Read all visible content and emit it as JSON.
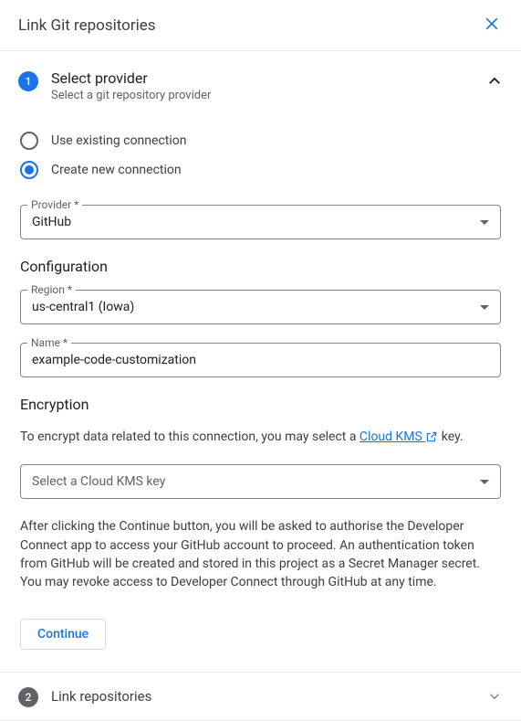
{
  "dialog": {
    "title": "Link Git repositories"
  },
  "step1": {
    "number": "1",
    "title": "Select provider",
    "subtitle": "Select a git repository provider"
  },
  "radio": {
    "existing_label": "Use existing connection",
    "new_label": "Create new connection"
  },
  "provider_field": {
    "label": "Provider *",
    "value": "GitHub"
  },
  "config": {
    "heading": "Configuration",
    "region_label": "Region *",
    "region_value": "us-central1 (Iowa)",
    "name_label": "Name *",
    "name_value": "example-code-customization"
  },
  "encryption": {
    "heading": "Encryption",
    "info_prefix": "To encrypt data related to this connection, you may select a ",
    "link_text": "Cloud KMS",
    "info_suffix": " key.",
    "kms_placeholder": "Select a Cloud KMS key"
  },
  "footer": {
    "disclaimer": "After clicking the Continue button, you will be asked to authorise the Developer Connect app to access your GitHub account to proceed. An authentication token from GitHub will be created and stored in this project as a Secret Manager secret. You may revoke access to Developer Connect through GitHub at any time.",
    "continue_label": "Continue"
  },
  "step2": {
    "number": "2",
    "title": "Link repositories"
  }
}
